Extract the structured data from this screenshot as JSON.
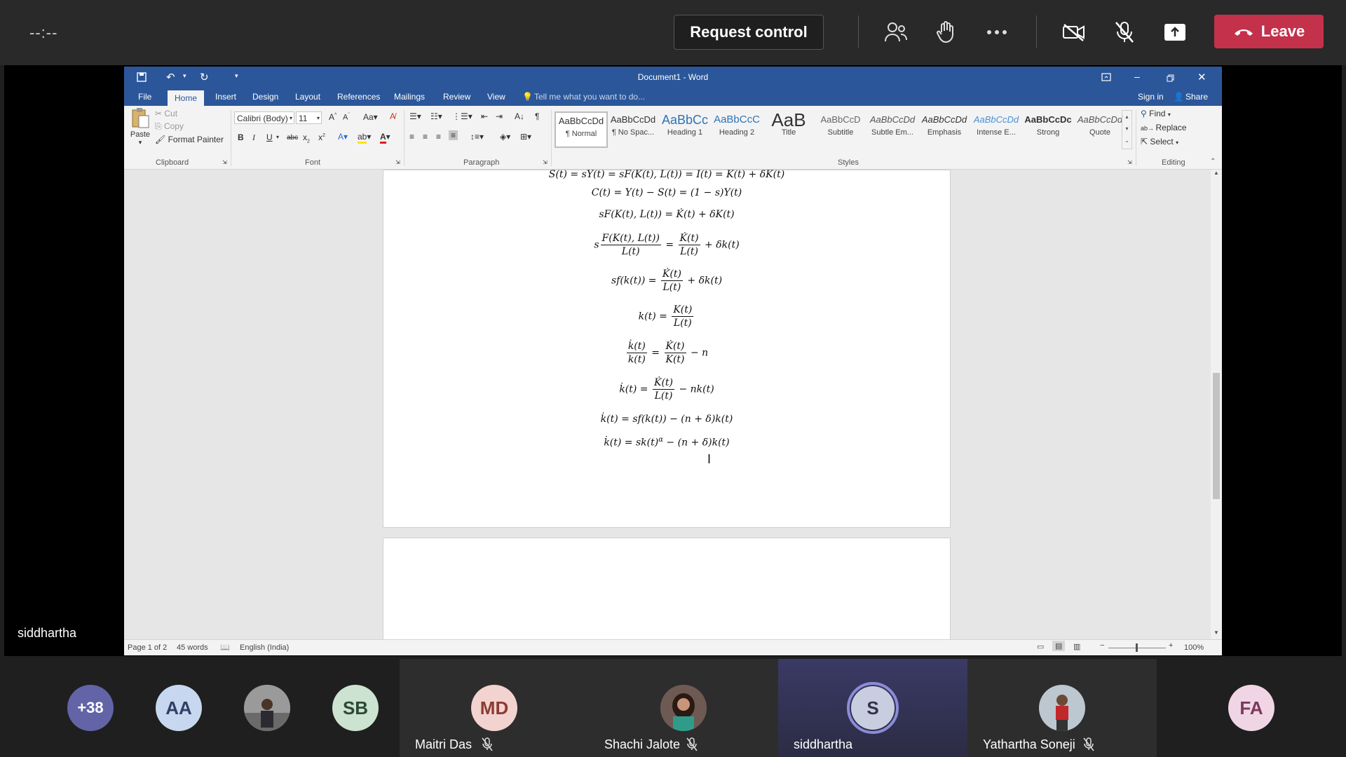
{
  "meeting": {
    "timer": "--:--",
    "request_control_label": "Request control",
    "leave_label": "Leave",
    "presenter_name": "siddhartha",
    "colors": {
      "leave": "#c4314b",
      "bar": "#292929"
    }
  },
  "word": {
    "window_title": "Document1 - Word",
    "tabs": [
      "File",
      "Home",
      "Insert",
      "Design",
      "Layout",
      "References",
      "Mailings",
      "Review",
      "View"
    ],
    "tell_me_placeholder": "Tell me what you want to do...",
    "sign_in": "Sign in",
    "share": "Share",
    "clipboard": {
      "paste": "Paste",
      "cut": "Cut",
      "copy": "Copy",
      "format_painter": "Format Painter",
      "label": "Clipboard"
    },
    "font": {
      "name": "Calibri (Body)",
      "size": "11",
      "label": "Font"
    },
    "paragraph_label": "Paragraph",
    "styles_label": "Styles",
    "styles": [
      {
        "preview": "AaBbCcDd",
        "name": "¶ Normal"
      },
      {
        "preview": "AaBbCcDd",
        "name": "¶ No Spac..."
      },
      {
        "preview": "AaBbCc",
        "name": "Heading 1"
      },
      {
        "preview": "AaBbCcC",
        "name": "Heading 2"
      },
      {
        "preview": "AaB",
        "name": "Title"
      },
      {
        "preview": "AaBbCcD",
        "name": "Subtitle"
      },
      {
        "preview": "AaBbCcDd",
        "name": "Subtle Em..."
      },
      {
        "preview": "AaBbCcDd",
        "name": "Emphasis"
      },
      {
        "preview": "AaBbCcDd",
        "name": "Intense E..."
      },
      {
        "preview": "AaBbCcDc",
        "name": "Strong"
      },
      {
        "preview": "AaBbCcDd",
        "name": "Quote"
      }
    ],
    "editing": {
      "find": "Find",
      "replace": "Replace",
      "select": "Select",
      "label": "Editing"
    },
    "status": {
      "page": "Page 1 of 2",
      "words": "45 words",
      "language": "English (India)",
      "zoom": "100%"
    }
  },
  "participants": [
    {
      "initials": "+38",
      "name": "",
      "color": "#6264a7"
    },
    {
      "initials": "AA",
      "name": "",
      "color": "#c7d7ef"
    },
    {
      "initials": "",
      "name": "",
      "color": "#5a5a5a"
    },
    {
      "initials": "SB",
      "name": "",
      "color": "#cde3d2"
    },
    {
      "initials": "MD",
      "name": "Maitri Das",
      "color": "#f3d3cf"
    },
    {
      "initials": "",
      "name": "Shachi Jalote",
      "color": "#4a4a4a"
    },
    {
      "initials": "S",
      "name": "siddhartha",
      "color": "#c8cde0"
    },
    {
      "initials": "",
      "name": "Yathartha Soneji",
      "color": "#5a5a5a"
    },
    {
      "initials": "FA",
      "name": "",
      "color": "#f0d6e4"
    }
  ]
}
